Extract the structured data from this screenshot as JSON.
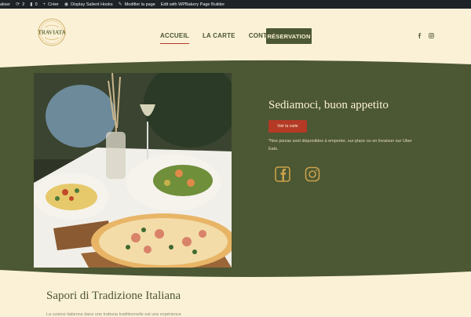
{
  "admin_bar": {
    "items": [
      {
        "icon": "customize-icon",
        "label": "aliser"
      },
      {
        "icon": "updates-icon",
        "label": "2"
      },
      {
        "icon": "comments-icon",
        "label": "0"
      },
      {
        "icon": "plus-icon",
        "label": "Créer"
      },
      {
        "icon": "eye-icon",
        "label": "Display Salient Hooks"
      },
      {
        "icon": "pencil-icon",
        "label": "Modifier la page"
      },
      {
        "icon": "",
        "label": "Edit with WPBakery Page Builder"
      }
    ]
  },
  "header": {
    "logo_text": "TRAVIATA",
    "nav": [
      {
        "label": "ACCUEIL",
        "active": true
      },
      {
        "label": "LA CARTE",
        "active": false
      },
      {
        "label": "CONTACT",
        "active": false
      }
    ],
    "reservation_label": "RÉSERVATION",
    "social": [
      "facebook-icon",
      "instagram-icon"
    ]
  },
  "hero": {
    "title": "Sediamoci, buon appetito",
    "button_label": "Voir la carte",
    "note": "*Nos pizzas sont disponibles à emporter, sur place ou en livraison sur Uber Eats.",
    "social": [
      "facebook-icon",
      "instagram-icon"
    ]
  },
  "section": {
    "title": "Sapori di Tradizione Italiana",
    "text": "La cuisine italienne dans une trattoria traditionnelle est une expérience"
  },
  "colors": {
    "cream": "#fbf1d7",
    "olive": "#4c5733",
    "rust": "#b43a26",
    "gold": "#c9a24a"
  }
}
